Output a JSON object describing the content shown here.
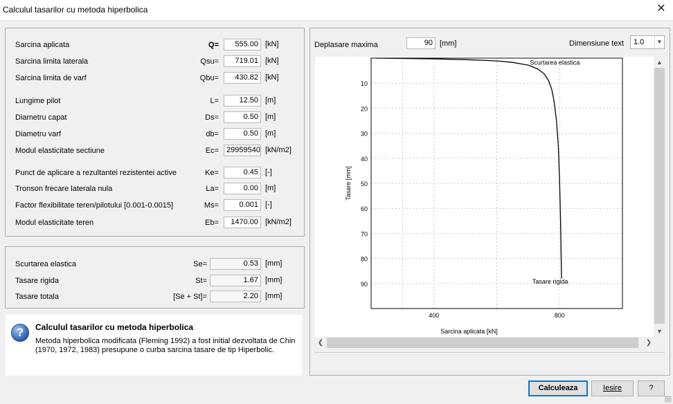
{
  "window": {
    "title": "Calculul tasarilor cu metoda hiperbolica",
    "close_glyph": "✕"
  },
  "inputs": [
    {
      "id": "sarcina-aplicata",
      "label": "Sarcina aplicata",
      "symbol": "Q=",
      "value": "555.00",
      "unit": "[kN]"
    },
    {
      "id": "sarcina-limita-laterala",
      "label": "Sarcina limita laterala",
      "symbol": "Qsu=",
      "value": "719.01",
      "unit": "[kN]"
    },
    {
      "id": "sarcina-limita-varf",
      "label": "Sarcina limita de varf",
      "symbol": "Qbu=",
      "value": "430.82",
      "unit": "[kN]"
    },
    {
      "id": "lungime-pilot",
      "label": "Lungime pilot",
      "symbol": "L=",
      "value": "12.50",
      "unit": "[m]"
    },
    {
      "id": "diametru-capat",
      "label": "Diametru capat",
      "symbol": "Ds=",
      "value": "0.50",
      "unit": "[m]"
    },
    {
      "id": "diametru-varf",
      "label": "Diametru varf",
      "symbol": "db=",
      "value": "0.50",
      "unit": "[m]"
    },
    {
      "id": "modul-elasticitate-sectiune",
      "label": "Modul elasticitate sectiune",
      "symbol": "Ec=",
      "value": "29959540",
      "unit": "[kN/m2]"
    },
    {
      "id": "punct-aplicare",
      "label": "Punct de aplicare a rezultantei rezistentei active",
      "symbol": "Ke=",
      "value": "0.45",
      "unit": "[-]"
    },
    {
      "id": "tronson-frecare",
      "label": "Tronson frecare laterala nula",
      "symbol": "La=",
      "value": "0.00",
      "unit": "[m]"
    },
    {
      "id": "factor-flexibilitate",
      "label": "Factor flexibilitate teren/pilotului [0.001-0.0015]",
      "symbol": "Ms=",
      "value": "0.001",
      "unit": "[-]"
    },
    {
      "id": "modul-elasticitate-teren",
      "label": "Modul elasticitate teren",
      "symbol": "Eb=",
      "value": "1470.00",
      "unit": "[kN/m2]"
    }
  ],
  "results": [
    {
      "id": "scurtarea-elastica",
      "label": "Scurtarea elastica",
      "symbol": "Se=",
      "value": "0.53",
      "unit": "[mm]"
    },
    {
      "id": "tasare-rigida",
      "label": "Tasare rigida",
      "symbol": "St=",
      "value": "1.67",
      "unit": "[mm]"
    },
    {
      "id": "tasare-totala",
      "label": "Tasare totala",
      "symbol": "[Se + St]=",
      "value": "2.20",
      "unit": "[mm]"
    }
  ],
  "help": {
    "icon": "question-icon",
    "title": "Calculul tasarilor cu metoda hiperbolica",
    "text": "Metoda hiperbolica modificata (Fleming 1992) a fost initial dezvoltata de Chin (1970, 1972, 1983) presupune o curba sarcina tasare de tip Hiperbolic."
  },
  "chart_controls": {
    "deplasare_label": "Deplasare maxima",
    "deplasare_value": "90",
    "deplasare_unit": "[mm]",
    "dimensiune_label": "Dimensiune text",
    "dimensiune_value": "1.0"
  },
  "buttons": {
    "calculeaza": "Calculeaza",
    "iesire": "Iesire",
    "help": "?"
  },
  "chart_data": {
    "type": "line",
    "xlabel": "Sarcina aplicata [kN]",
    "ylabel": "Tasare [mm]",
    "xlim": [
      200,
      1000
    ],
    "ylim": [
      0,
      100
    ],
    "y_inverted": true,
    "x_ticks": [
      400,
      800
    ],
    "y_ticks": [
      10,
      20,
      30,
      40,
      50,
      60,
      70,
      80,
      90
    ],
    "grid": true,
    "series": [
      {
        "color": "#000000",
        "x": [
          215,
          400,
          500,
          600,
          650,
          700,
          730,
          750,
          765,
          775,
          782,
          790,
          796,
          800,
          803,
          806
        ],
        "y": [
          0.0,
          0.3,
          0.6,
          1.1,
          1.7,
          2.8,
          4.3,
          6.2,
          9.0,
          12.5,
          17.0,
          25.0,
          35.0,
          50.0,
          65.0,
          88.0
        ]
      }
    ],
    "annotations": [
      {
        "text": "Scurtarea elastica",
        "x": 785,
        "y": 1.5
      },
      {
        "text": "Tasare rigida",
        "x": 770,
        "y": 89
      }
    ]
  }
}
